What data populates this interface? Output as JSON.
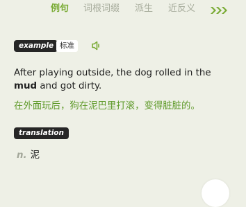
{
  "tabs": [
    {
      "label": "例句",
      "active": true
    },
    {
      "label": "词根词缀",
      "active": false
    },
    {
      "label": "派生",
      "active": false
    },
    {
      "label": "近反义",
      "active": false
    }
  ],
  "more_icon": "triple-chevron-right-icon",
  "example": {
    "badge": "example",
    "tag": "标准",
    "speaker_icon": "speaker-icon",
    "sentence_before": "After playing outside, the dog rolled in the ",
    "keyword": "mud",
    "sentence_after": " and got dirty.",
    "translation": "在外面玩后，狗在泥巴里打滚，变得脏脏的。"
  },
  "translation_section": {
    "badge": "translation",
    "pos": "n.",
    "meaning": "泥"
  },
  "colors": {
    "background": "#eef0e6",
    "accent_green": "#7aab35",
    "tab_inactive": "#a6ab9b",
    "badge_dark": "#262626",
    "translation_green": "#5f9a2a"
  }
}
